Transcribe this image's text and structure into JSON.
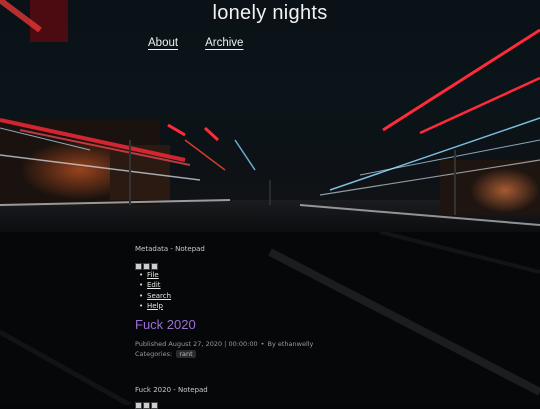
{
  "site": {
    "title": "lonely nights"
  },
  "nav": [
    {
      "label": "About"
    },
    {
      "label": "Archive"
    }
  ],
  "windows": [
    {
      "title": "Metadata - Notepad",
      "menu": [
        "File",
        "Edit",
        "Search",
        "Help"
      ]
    },
    {
      "title": "Fuck 2020 - Notepad"
    }
  ],
  "post": {
    "title": "Fuck 2020",
    "published": "Published August 27, 2020 | 00:00:00",
    "author": "By ethanwelly",
    "categories_label": "Categories:",
    "category": "rant"
  },
  "colors": {
    "accent": "#9b6fd6",
    "streak_red": "#ff2a3a",
    "streak_cyan": "#7fd6ff"
  }
}
